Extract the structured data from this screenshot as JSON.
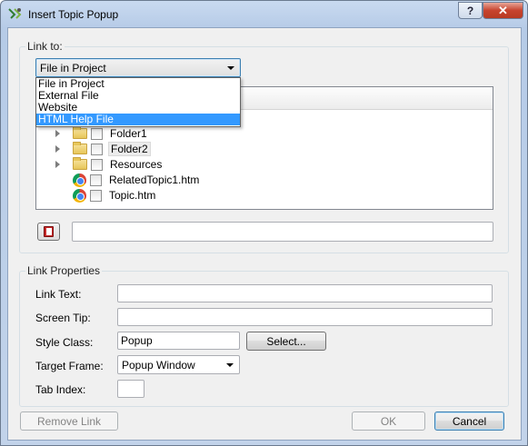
{
  "window": {
    "title": "Insert Topic Popup",
    "help_label": "?",
    "close_label": "✕"
  },
  "link_to": {
    "group_label": "Link to:",
    "selected": "File in Project",
    "options": [
      "File in Project",
      "External File",
      "Website",
      "HTML Help File"
    ],
    "highlighted_option": "HTML Help File"
  },
  "tree": {
    "items": [
      {
        "label": "Folder1",
        "icon": "folder-icon",
        "expandable": true
      },
      {
        "label": "Folder2",
        "icon": "folder-icon",
        "expandable": true,
        "selected": true
      },
      {
        "label": "Resources",
        "icon": "folder-icon",
        "expandable": true
      },
      {
        "label": "RelatedTopic1.htm",
        "icon": "chrome-icon",
        "expandable": false
      },
      {
        "label": "Topic.htm",
        "icon": "chrome-icon",
        "expandable": false
      }
    ]
  },
  "link_path_value": "",
  "link_properties": {
    "group_label": "Link Properties",
    "link_text_label": "Link Text:",
    "link_text_value": "",
    "screen_tip_label": "Screen Tip:",
    "screen_tip_value": "",
    "style_class_label": "Style Class:",
    "style_class_value": "Popup",
    "select_button": "Select...",
    "target_frame_label": "Target Frame:",
    "target_frame_value": "Popup Window",
    "tab_index_label": "Tab Index:",
    "tab_index_value": ""
  },
  "buttons": {
    "remove_link": "Remove Link",
    "ok": "OK",
    "cancel": "Cancel"
  },
  "colors": {
    "highlight": "#3399ff",
    "close_button": "#c7432e"
  }
}
